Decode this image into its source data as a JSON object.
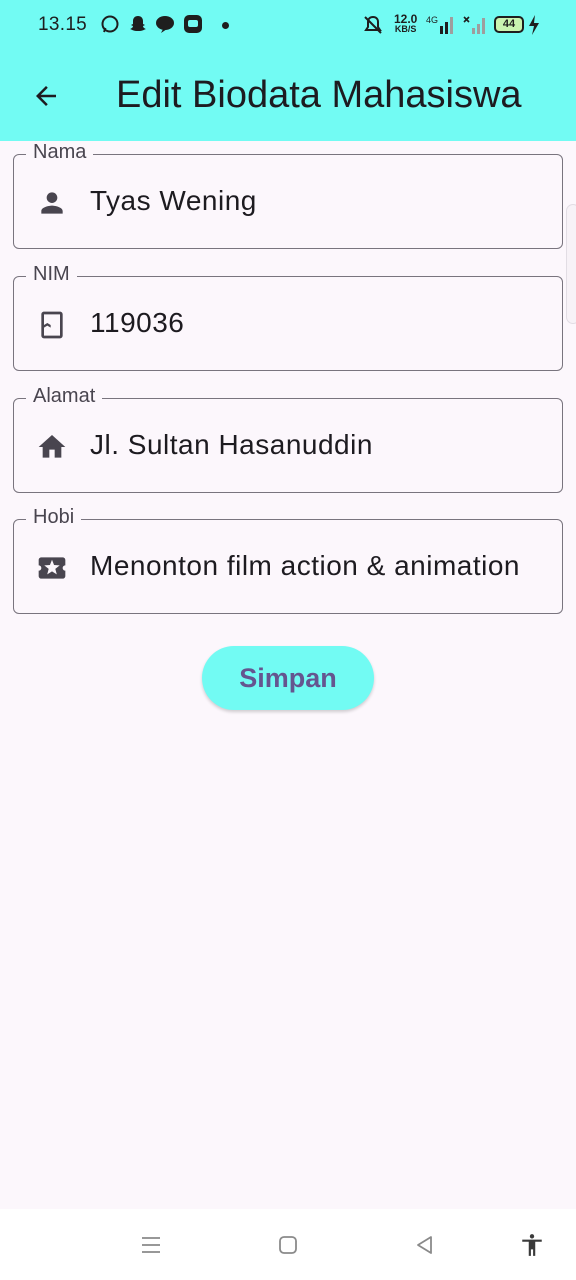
{
  "status_bar": {
    "time": "13.15",
    "speed_value": "12.0",
    "speed_unit": "KB/S",
    "battery": "44",
    "network": "4G"
  },
  "app_bar": {
    "title": "Edit Biodata Mahasiswa",
    "background": "#72fbf3",
    "back_icon": "arrow-left-icon"
  },
  "form": {
    "fields": [
      {
        "label": "Nama",
        "value": "Tyas Wening",
        "icon": "person-icon"
      },
      {
        "label": "NIM",
        "value": "119036",
        "icon": "bookmark-book-icon"
      },
      {
        "label": "Alamat",
        "value": "Jl. Sultan Hasanuddin",
        "icon": "home-icon"
      },
      {
        "label": "Hobi",
        "value": "Menonton film action & animation",
        "icon": "ticket-star-icon"
      }
    ],
    "submit_label": "Simpan",
    "submit_color": "#72fbf3",
    "submit_text_color": "#65558f"
  },
  "nav_bar": {
    "buttons": [
      "menu-icon",
      "home-square-icon",
      "back-triangle-icon",
      "accessibility-icon"
    ]
  }
}
